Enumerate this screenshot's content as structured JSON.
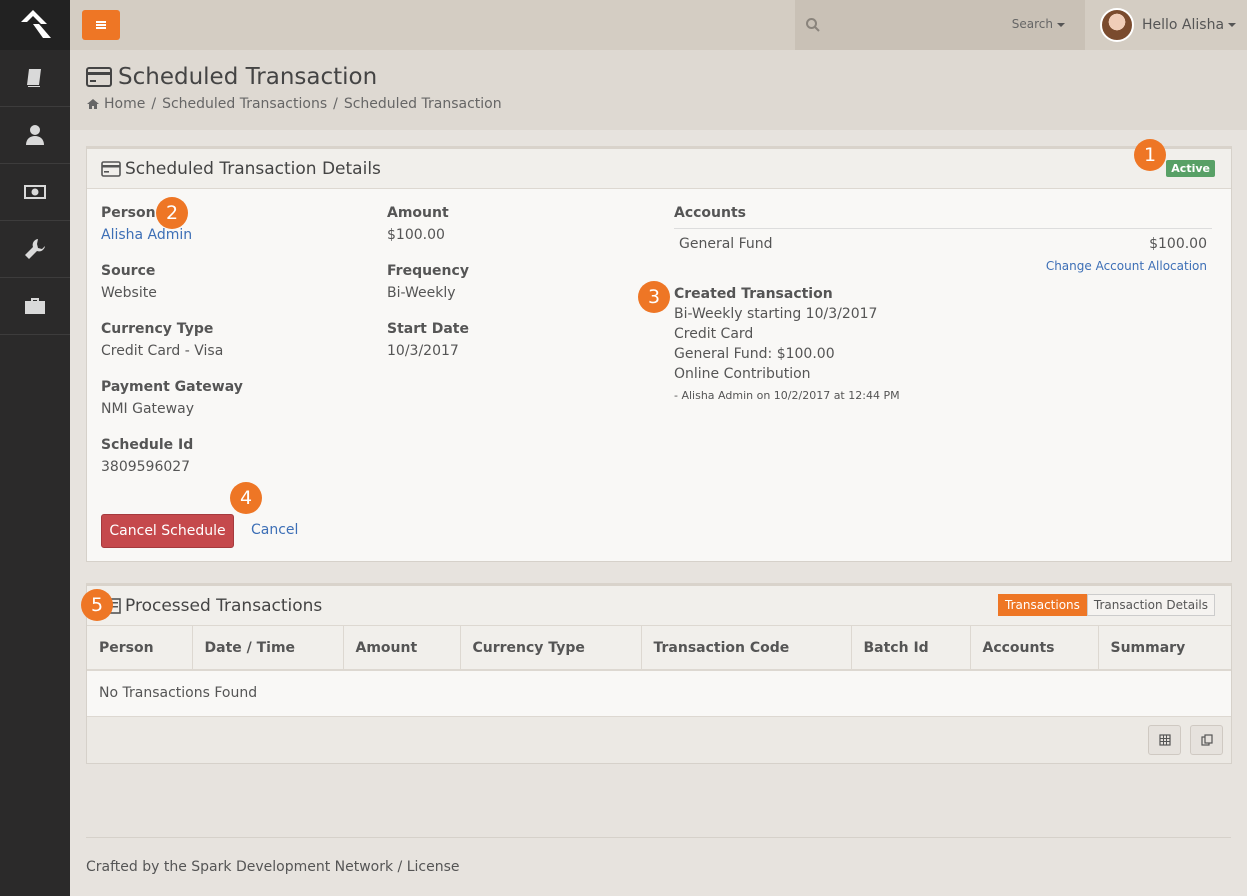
{
  "topbar": {
    "search_button_label": "Search",
    "user_greeting": "Hello Alisha"
  },
  "page": {
    "title": "Scheduled Transaction",
    "breadcrumb": [
      "Home",
      "Scheduled Transactions",
      "Scheduled Transaction"
    ]
  },
  "details": {
    "panel_title": "Scheduled Transaction Details",
    "status": "Active",
    "person_label": "Person",
    "person_value": "Alisha Admin",
    "source_label": "Source",
    "source_value": "Website",
    "currency_label": "Currency Type",
    "currency_value": "Credit Card - Visa",
    "gateway_label": "Payment Gateway",
    "gateway_value": "NMI Gateway",
    "schedule_label": "Schedule Id",
    "schedule_value": "3809596027",
    "amount_label": "Amount",
    "amount_value": "$100.00",
    "frequency_label": "Frequency",
    "frequency_value": "Bi-Weekly",
    "start_label": "Start Date",
    "start_value": "10/3/2017",
    "accounts_label": "Accounts",
    "account_name": "General Fund",
    "account_amount": "$100.00",
    "change_allocation": "Change Account Allocation",
    "created_label": "Created Transaction",
    "created_lines": [
      "Bi-Weekly starting 10/3/2017",
      "Credit Card",
      "General Fund: $100.00",
      "Online Contribution"
    ],
    "created_meta": "- Alisha Admin on 10/2/2017 at 12:44 PM",
    "cancel_schedule_button": "Cancel Schedule",
    "cancel_link": "Cancel"
  },
  "callouts": [
    "1",
    "2",
    "3",
    "4",
    "5"
  ],
  "processed": {
    "panel_title": "Processed Transactions",
    "toggle": [
      "Transactions",
      "Transaction Details"
    ],
    "columns": [
      "Person",
      "Date / Time",
      "Amount",
      "Currency Type",
      "Transaction Code",
      "Batch Id",
      "Accounts",
      "Summary"
    ],
    "empty_text": "No Transactions Found"
  },
  "footer": {
    "text": "Crafted by the Spark Development Network / License"
  },
  "colors": {
    "accent": "#ee7625",
    "danger": "#c5494c",
    "success": "#58a066",
    "link": "#3d6fb6"
  }
}
